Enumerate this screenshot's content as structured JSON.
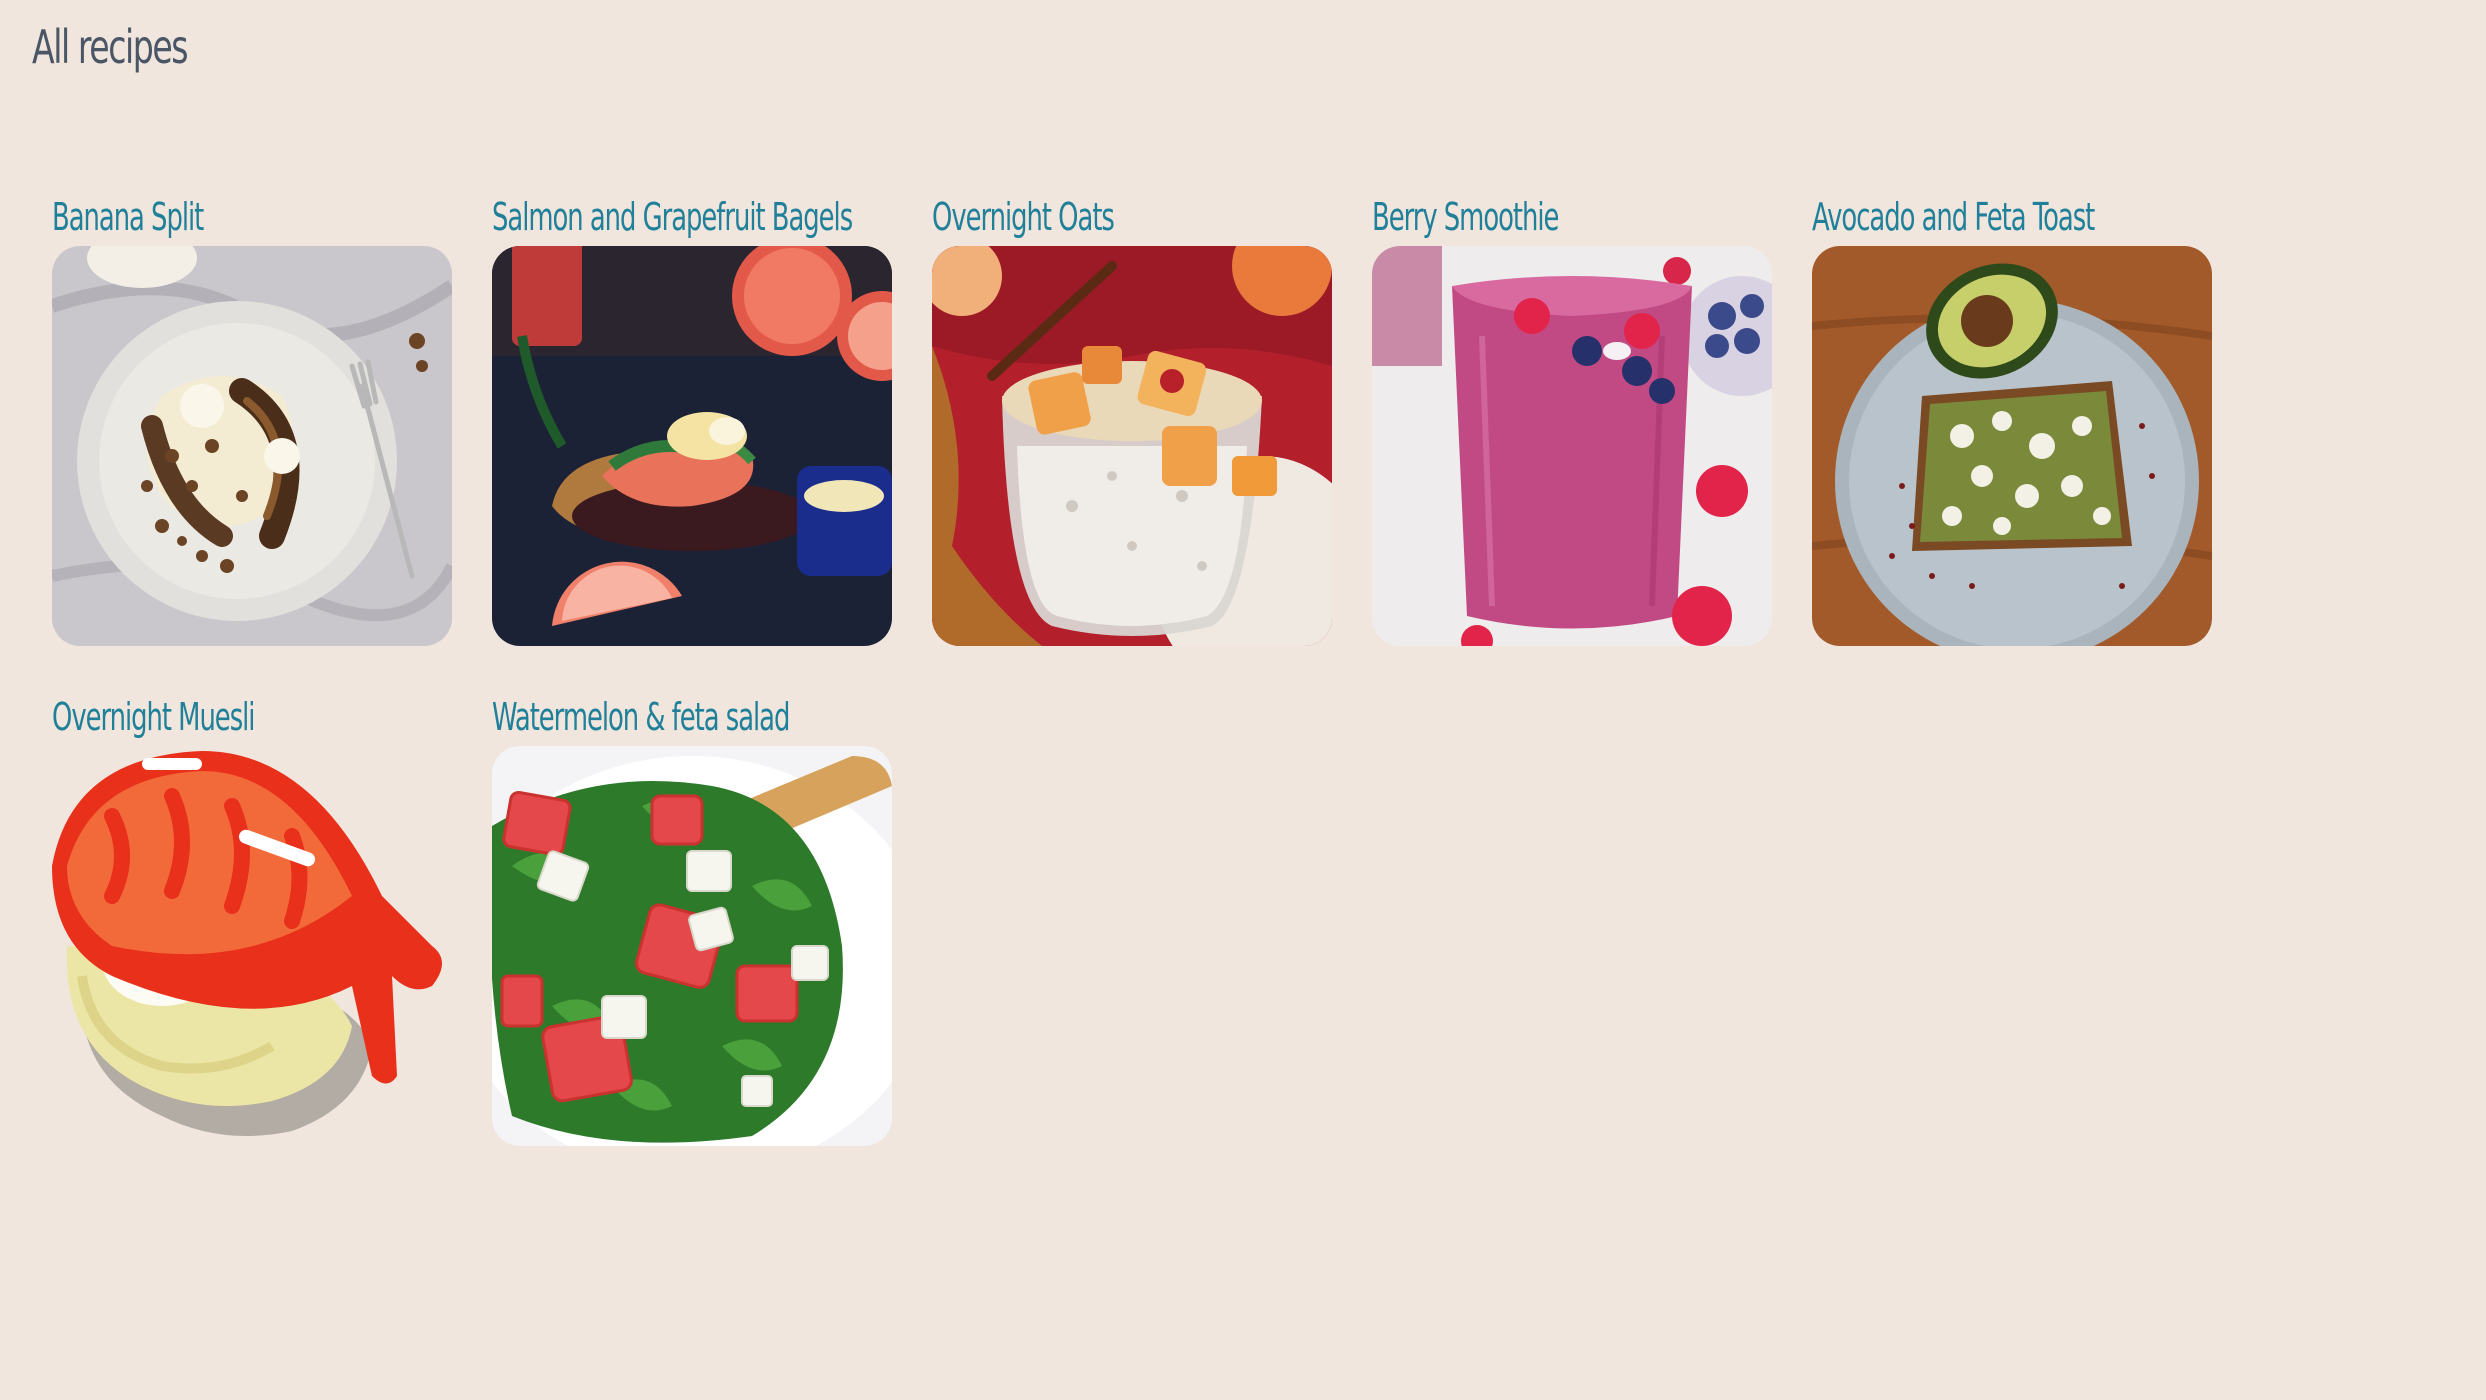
{
  "page": {
    "title": "All recipes"
  },
  "recipes": [
    {
      "title": "Banana Split",
      "image": "banana-split-photo"
    },
    {
      "title": "Salmon and Grapefruit Bagels",
      "image": "salmon-grapefruit-bagel-photo"
    },
    {
      "title": "Overnight Oats",
      "image": "overnight-oats-photo"
    },
    {
      "title": "Berry Smoothie",
      "image": "berry-smoothie-photo"
    },
    {
      "title": "Avocado and Feta Toast",
      "image": "avocado-feta-toast-photo"
    },
    {
      "title": "Overnight Muesli",
      "image": "sushi-nigiri-illustration"
    },
    {
      "title": "Watermelon & feta salad",
      "image": "watermelon-feta-salad-photo"
    }
  ],
  "colors": {
    "background": "#f0e6de",
    "title": "#4a5566",
    "recipe_title": "#20809a"
  }
}
